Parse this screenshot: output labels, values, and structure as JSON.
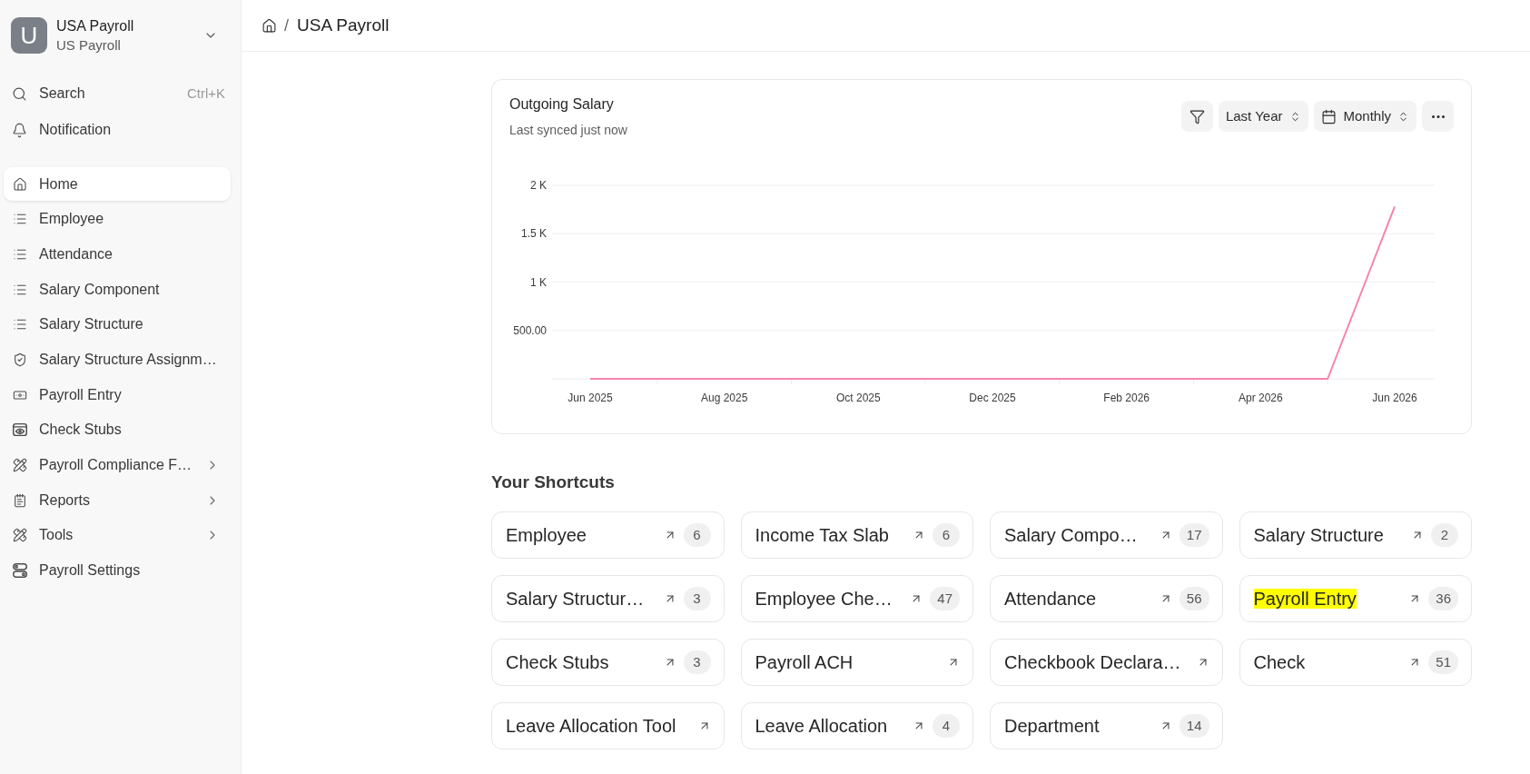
{
  "sidebar": {
    "workspace": {
      "initial": "U",
      "title": "USA Payroll",
      "subtitle": "US Payroll"
    },
    "search": {
      "label": "Search",
      "shortcut": "Ctrl+K"
    },
    "notification": {
      "label": "Notification"
    },
    "items": [
      {
        "label": "Home",
        "selected": true,
        "submenu": false
      },
      {
        "label": "Employee",
        "selected": false,
        "submenu": false
      },
      {
        "label": "Attendance",
        "selected": false,
        "submenu": false
      },
      {
        "label": "Salary Component",
        "selected": false,
        "submenu": false
      },
      {
        "label": "Salary Structure",
        "selected": false,
        "submenu": false
      },
      {
        "label": "Salary Structure Assignm…",
        "selected": false,
        "submenu": false
      },
      {
        "label": "Payroll Entry",
        "selected": false,
        "submenu": false
      },
      {
        "label": "Check Stubs",
        "selected": false,
        "submenu": false
      },
      {
        "label": "Payroll Compliance F…",
        "selected": false,
        "submenu": true
      },
      {
        "label": "Reports",
        "selected": false,
        "submenu": true
      },
      {
        "label": "Tools",
        "selected": false,
        "submenu": true
      },
      {
        "label": "Payroll Settings",
        "selected": false,
        "submenu": false
      }
    ]
  },
  "breadcrumb": {
    "separator": "/",
    "current": "USA Payroll"
  },
  "chart_card": {
    "title": "Outgoing Salary",
    "subtitle": "Last synced just now",
    "period": "Last Year",
    "interval": "Monthly",
    "chart_data": {
      "type": "line",
      "categories": [
        "Jun 2025",
        null,
        "Aug 2025",
        null,
        "Oct 2025",
        null,
        "Dec 2025",
        null,
        "Feb 2026",
        null,
        "Apr 2026",
        null,
        "Jun 2026"
      ],
      "series": [
        {
          "color": "#f683ae",
          "values": [
            0,
            0,
            0,
            0,
            0,
            0,
            0,
            0,
            0,
            0,
            0,
            0,
            1780
          ]
        }
      ],
      "ylim": [
        0,
        2000
      ],
      "yticks": [
        {
          "value": 500,
          "label": "500.00"
        },
        {
          "value": 1000,
          "label": "1 K"
        },
        {
          "value": 1500,
          "label": "1.5 K"
        },
        {
          "value": 2000,
          "label": "2 K"
        }
      ],
      "grid": true
    }
  },
  "shortcuts": {
    "title": "Your Shortcuts",
    "items": [
      {
        "label": "Employee",
        "count": "6",
        "highlighted": false
      },
      {
        "label": "Income Tax Slab",
        "count": "6",
        "highlighted": false
      },
      {
        "label": "Salary Compo…",
        "count": "17",
        "highlighted": false
      },
      {
        "label": "Salary Structure",
        "count": "2",
        "highlighted": false
      },
      {
        "label": "Salary Structur…",
        "count": "3",
        "highlighted": false
      },
      {
        "label": "Employee Che…",
        "count": "47",
        "highlighted": false
      },
      {
        "label": "Attendance",
        "count": "56",
        "highlighted": false
      },
      {
        "label": "Payroll Entry",
        "count": "36",
        "highlighted": true
      },
      {
        "label": "Check Stubs",
        "count": "3",
        "highlighted": false
      },
      {
        "label": "Payroll ACH",
        "highlighted": false
      },
      {
        "label": "Checkbook Declara…",
        "highlighted": false
      },
      {
        "label": "Check",
        "count": "51",
        "highlighted": false
      },
      {
        "label": "Leave Allocation Tool",
        "highlighted": false
      },
      {
        "label": "Leave Allocation",
        "count": "4",
        "highlighted": false
      },
      {
        "label": "Department",
        "count": "14",
        "highlighted": false
      }
    ]
  }
}
